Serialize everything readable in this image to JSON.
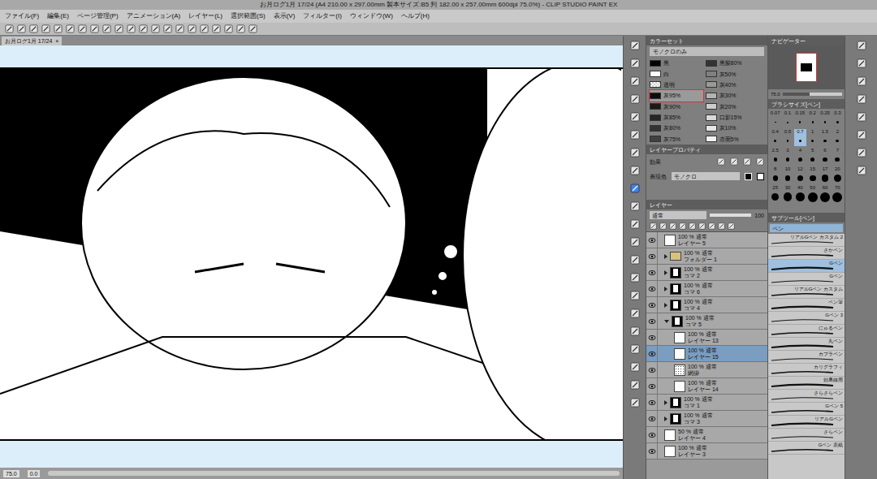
{
  "window": {
    "title": "お月ログ1月 17/24 (A4 210.00 x 297.00mm 製本サイズ:B5 判 182.00 x 257.00mm 600dpi 75.0%) - CLIP STUDIO PAINT EX"
  },
  "menu": [
    "ファイル(F)",
    "編集(E)",
    "ページ管理(P)",
    "アニメーション(A)",
    "レイヤー(L)",
    "選択範囲(S)",
    "表示(V)",
    "フィルター(I)",
    "ウィンドウ(W)",
    "ヘルプ(H)"
  ],
  "document_tab": {
    "label": "お月ログ1月 17/24",
    "close": "×"
  },
  "status_bar": {
    "zoom": "75.0",
    "angle": "0.0"
  },
  "tools": [
    {
      "selected": false
    },
    {
      "selected": false
    },
    {
      "selected": false
    },
    {
      "selected": false
    },
    {
      "selected": false
    },
    {
      "selected": false
    },
    {
      "selected": false
    },
    {
      "selected": false
    },
    {
      "selected": true
    },
    {
      "selected": false
    },
    {
      "selected": false
    },
    {
      "selected": false
    },
    {
      "selected": false
    },
    {
      "selected": false
    },
    {
      "selected": false
    },
    {
      "selected": false
    },
    {
      "selected": false
    },
    {
      "selected": false
    },
    {
      "selected": false
    },
    {
      "selected": false
    },
    {
      "selected": false
    }
  ],
  "color_set": {
    "title": "カラーセット",
    "set": "モノクロのみ",
    "colors": [
      {
        "name": "黒",
        "color": "#000000",
        "kind": "swatch",
        "selected": false
      },
      {
        "name": "白",
        "color": "#ffffff",
        "kind": "swatch",
        "selected": false
      },
      {
        "name": "透明",
        "color": "#ffffff",
        "kind": "transparent",
        "selected": false
      },
      {
        "name": "灰95%",
        "color": "#0d0d0d",
        "kind": "swatch",
        "selected": true
      },
      {
        "name": "灰90%",
        "color": "#1a1a1a",
        "kind": "swatch",
        "selected": false
      },
      {
        "name": "灰85%",
        "color": "#262626",
        "kind": "swatch",
        "selected": false
      },
      {
        "name": "灰80%",
        "color": "#333333",
        "kind": "swatch",
        "selected": false
      },
      {
        "name": "灰75%",
        "color": "#404040",
        "kind": "swatch",
        "selected": false
      },
      {
        "name": "黒髪80%",
        "color": "#333333",
        "kind": "swatch",
        "selected": false
      },
      {
        "name": "灰50%",
        "color": "#808080",
        "kind": "swatch",
        "selected": false
      },
      {
        "name": "灰40%",
        "color": "#999999",
        "kind": "swatch",
        "selected": false
      },
      {
        "name": "灰30%",
        "color": "#b3b3b3",
        "kind": "swatch",
        "selected": false
      },
      {
        "name": "灰20%",
        "color": "#cccccc",
        "kind": "swatch",
        "selected": false
      },
      {
        "name": "口影15%",
        "color": "#d9d9d9",
        "kind": "swatch",
        "selected": false
      },
      {
        "name": "灰10%",
        "color": "#e6e6e6",
        "kind": "swatch",
        "selected": false
      },
      {
        "name": "赤面5%",
        "color": "#f2f2f2",
        "kind": "swatch",
        "selected": false
      }
    ]
  },
  "layer_property": {
    "title": "レイヤープロパティ",
    "effect_label": "効果",
    "color_label": "表現色",
    "color_mode": "モノクロ"
  },
  "layers": {
    "title": "レイヤー",
    "blend": "通常",
    "opacity": "100",
    "items": [
      {
        "opacity": "100 %",
        "blend": "通常",
        "name": "レイヤー 5",
        "kind": "layer",
        "depth": 0,
        "visible": true,
        "selected": false,
        "expanded": false
      },
      {
        "opacity": "100 %",
        "blend": "通常",
        "name": "フォルダー 1",
        "kind": "folder",
        "depth": 0,
        "visible": true,
        "selected": false,
        "expanded": false
      },
      {
        "opacity": "100 %",
        "blend": "通常",
        "name": "コマ 2",
        "kind": "frame",
        "depth": 0,
        "visible": true,
        "selected": false,
        "expanded": false
      },
      {
        "opacity": "100 %",
        "blend": "通常",
        "name": "コマ 6",
        "kind": "frame",
        "depth": 0,
        "visible": true,
        "selected": false,
        "expanded": false
      },
      {
        "opacity": "100 %",
        "blend": "通常",
        "name": "コマ 4",
        "kind": "frame",
        "depth": 0,
        "visible": true,
        "selected": false,
        "expanded": false
      },
      {
        "opacity": "100 %",
        "blend": "通常",
        "name": "コマ 5",
        "kind": "frame",
        "depth": 0,
        "visible": true,
        "selected": false,
        "expanded": true
      },
      {
        "opacity": "100 %",
        "blend": "通常",
        "name": "レイヤー 13",
        "kind": "layer",
        "depth": 1,
        "visible": true,
        "selected": false,
        "expanded": false
      },
      {
        "opacity": "100 %",
        "blend": "通常",
        "name": "レイヤー 15",
        "kind": "layer",
        "depth": 1,
        "visible": true,
        "selected": true,
        "expanded": false
      },
      {
        "opacity": "100 %",
        "blend": "通常",
        "name": "網掛",
        "kind": "tone",
        "depth": 1,
        "visible": true,
        "selected": false,
        "expanded": false
      },
      {
        "opacity": "100 %",
        "blend": "通常",
        "name": "レイヤー 14",
        "kind": "layer",
        "depth": 1,
        "visible": true,
        "selected": false,
        "expanded": false
      },
      {
        "opacity": "100 %",
        "blend": "通常",
        "name": "コマ 1",
        "kind": "frame",
        "depth": 0,
        "visible": true,
        "selected": false,
        "expanded": false
      },
      {
        "opacity": "100 %",
        "blend": "通常",
        "name": "コマ 3",
        "kind": "frame",
        "depth": 0,
        "visible": true,
        "selected": false,
        "expanded": false
      },
      {
        "opacity": "50 %",
        "blend": "通常",
        "name": "レイヤー 4",
        "kind": "layer",
        "depth": 0,
        "visible": true,
        "selected": false,
        "expanded": false
      },
      {
        "opacity": "100 %",
        "blend": "通常",
        "name": "レイヤー 3",
        "kind": "layer",
        "depth": 0,
        "visible": true,
        "selected": false,
        "expanded": false
      }
    ]
  },
  "navigator": {
    "title": "ナビゲーター",
    "zoom": "75.0",
    "level": 0.45
  },
  "brush_size": {
    "title": "ブラシサイズ[ペン]",
    "sizes": [
      {
        "label": "0.07",
        "selected": false
      },
      {
        "label": "0.1",
        "selected": false
      },
      {
        "label": "0.15",
        "selected": false
      },
      {
        "label": "0.2",
        "selected": false
      },
      {
        "label": "0.25",
        "selected": false
      },
      {
        "label": "0.3",
        "selected": false
      },
      {
        "label": "0.4",
        "selected": false
      },
      {
        "label": "0.5",
        "selected": false
      },
      {
        "label": "0.7",
        "selected": true
      },
      {
        "label": "1",
        "selected": false
      },
      {
        "label": "1.5",
        "selected": false
      },
      {
        "label": "2",
        "selected": false
      },
      {
        "label": "2.5",
        "selected": false
      },
      {
        "label": "3",
        "selected": false
      },
      {
        "label": "4",
        "selected": false
      },
      {
        "label": "5",
        "selected": false
      },
      {
        "label": "6",
        "selected": false
      },
      {
        "label": "7",
        "selected": false
      },
      {
        "label": "8",
        "selected": false
      },
      {
        "label": "10",
        "selected": false
      },
      {
        "label": "12",
        "selected": false
      },
      {
        "label": "15",
        "selected": false
      },
      {
        "label": "17",
        "selected": false
      },
      {
        "label": "20",
        "selected": false
      },
      {
        "label": "25",
        "selected": false
      },
      {
        "label": "30",
        "selected": false
      },
      {
        "label": "40",
        "selected": false
      },
      {
        "label": "50",
        "selected": false
      },
      {
        "label": "60",
        "selected": false
      },
      {
        "label": "70",
        "selected": false
      }
    ]
  },
  "sub_tool": {
    "title": "サブツール[ペン]",
    "group": "ペン",
    "items": [
      {
        "name": "リアルGペン カスタム 2",
        "selected": false
      },
      {
        "name": "さかペン",
        "selected": false
      },
      {
        "name": "Gペン",
        "selected": true
      },
      {
        "name": "Gペン",
        "selected": false
      },
      {
        "name": "リアルGペン カスタム",
        "selected": false
      },
      {
        "name": "ペン筆",
        "selected": false
      },
      {
        "name": "Gペン 3",
        "selected": false
      },
      {
        "name": "にゅるペン",
        "selected": false
      },
      {
        "name": "丸ペン",
        "selected": false
      },
      {
        "name": "カブラペン",
        "selected": false
      },
      {
        "name": "カリグラフィ",
        "selected": false
      },
      {
        "name": "効果線用",
        "selected": false
      },
      {
        "name": "さらさらペン",
        "selected": false
      },
      {
        "name": "Gペン 5",
        "selected": false
      },
      {
        "name": "リアルGペン",
        "selected": false
      },
      {
        "name": "さらペン",
        "selected": false
      },
      {
        "name": "Gペン 表紙",
        "selected": false
      }
    ]
  },
  "right_tools": [
    {
      "selected": false
    },
    {
      "selected": false
    },
    {
      "selected": false
    },
    {
      "selected": false
    },
    {
      "selected": false
    },
    {
      "selected": false
    },
    {
      "selected": false
    },
    {
      "selected": false
    }
  ]
}
